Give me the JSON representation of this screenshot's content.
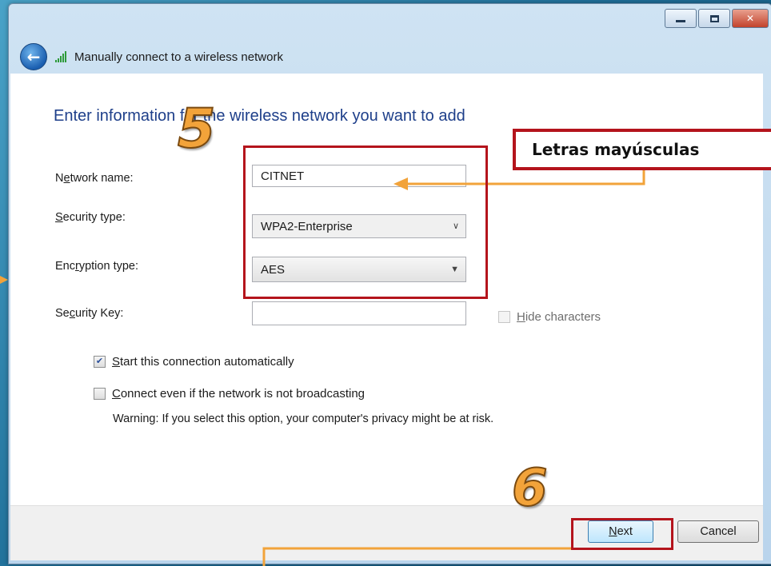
{
  "window": {
    "nav_title": "Manually connect to a wireless network"
  },
  "form": {
    "heading": "Enter information for the wireless network you want to add",
    "network_name": {
      "label_pre": "N",
      "label_ul": "e",
      "label_post": "twork name:",
      "value": "CITNET"
    },
    "security_type": {
      "label_pre": "",
      "label_ul": "S",
      "label_post": "ecurity type:",
      "value": "WPA2-Enterprise"
    },
    "encryption_type": {
      "label_pre": "Enc",
      "label_ul": "r",
      "label_post": "yption type:",
      "value": "AES"
    },
    "security_key": {
      "label_pre": "Se",
      "label_ul": "c",
      "label_post": "urity Key:",
      "value": ""
    },
    "hide_characters": {
      "label_ul": "H",
      "label_post": "ide characters",
      "checked": false
    },
    "auto_start": {
      "label_ul": "S",
      "label_post": "tart this connection automatically",
      "checked": true
    },
    "connect_hidden": {
      "label_ul": "C",
      "label_post": "onnect even if the network is not broadcasting",
      "checked": false
    },
    "warning": "Warning: If you select this option, your computer's privacy might be at risk."
  },
  "footer": {
    "next_ul": "N",
    "next_post": "ext",
    "cancel_label": "Cancel"
  },
  "annotations": {
    "callout": "Letras mayúsculas",
    "step5": "5",
    "step6": "6",
    "color": "#b4141c",
    "arrow_color": "#f2a33a"
  }
}
